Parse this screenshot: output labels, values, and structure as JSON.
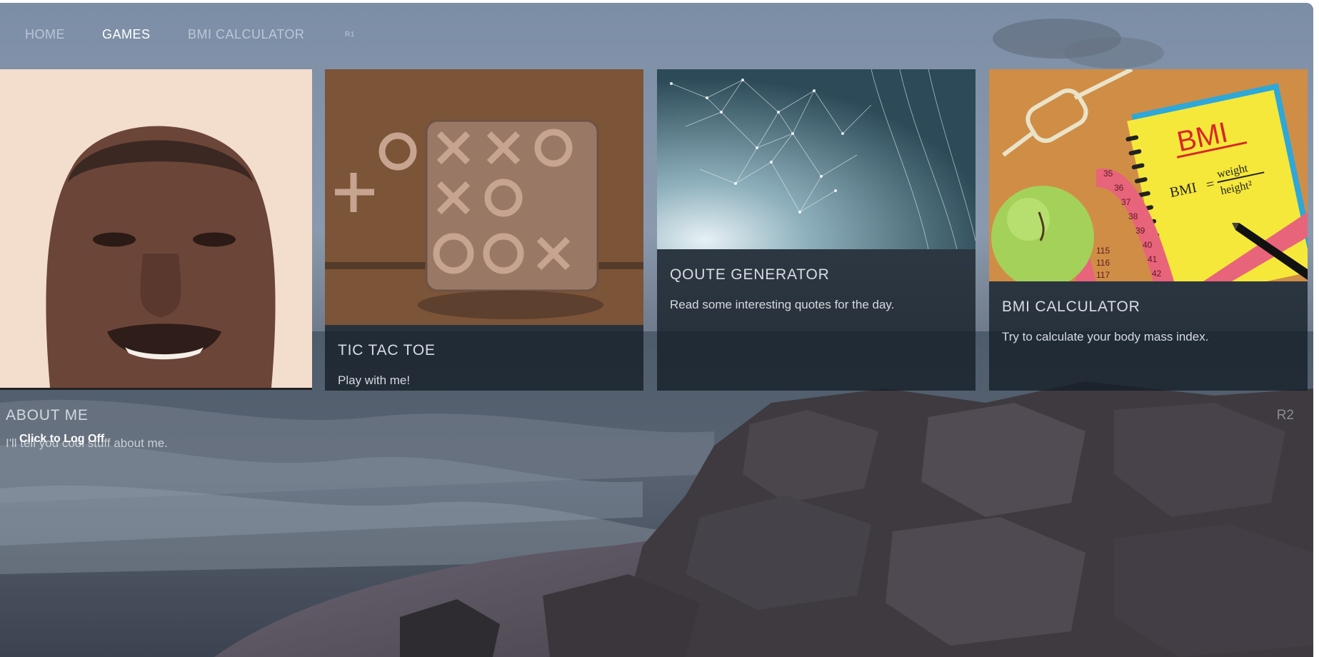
{
  "nav": {
    "items": [
      {
        "label": "HOME"
      },
      {
        "label": "GAMES"
      },
      {
        "label": "BMI CALCULATOR"
      },
      {
        "label": "R1"
      }
    ],
    "active": "GAMES"
  },
  "about": {
    "title": "ABOUT ME",
    "text": "I'll tell you cool stuff about me.",
    "logoff_label": "Click to Log Off"
  },
  "cards": [
    {
      "title": "TIC TAC TOE",
      "text": "Play with me!"
    },
    {
      "title": "QOUTE GENERATOR",
      "text": "Read some interesting quotes for the day."
    },
    {
      "title": "BMI CALCULATOR",
      "text": "Try to calculate your body mass index."
    }
  ],
  "bmi_image": {
    "heading": "BMI",
    "formula_left": "BMI",
    "formula_top": "weight",
    "formula_bottom": "height²"
  },
  "tape_numbers": [
    "35",
    "36",
    "37",
    "38",
    "39",
    "40",
    "41",
    "42",
    "115",
    "116",
    "117"
  ],
  "region_label": "R2",
  "colors": {
    "nav_active": "#ffffff",
    "nav_inactive": "#b9c3cd",
    "card_overlay": "#141e26",
    "notepad": "#f5e83a",
    "apple": "#a4d15a",
    "tape": "#e8647a"
  }
}
